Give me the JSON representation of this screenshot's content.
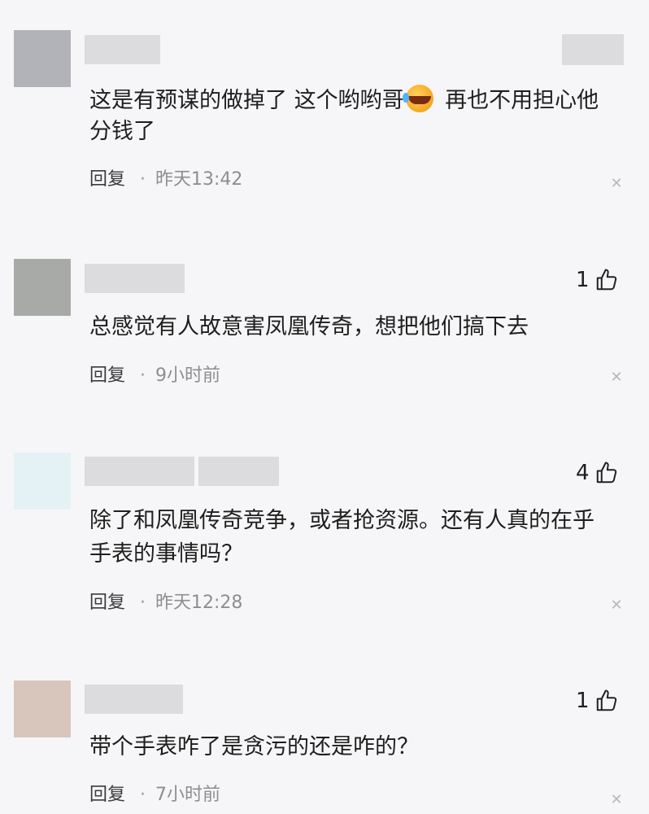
{
  "comments": [
    {
      "text_lines": [
        "这是有预谋的做掉了 这个哟哟哥",
        " 再也不用担心他",
        "分钱了"
      ],
      "emoji": "crying-laughing-emoji",
      "reply_label": "回复",
      "separator": "·",
      "time": "昨天13:42",
      "likes": ""
    },
    {
      "text_lines": [
        "总感觉有人故意害凤凰传奇，想把他们搞下去"
      ],
      "reply_label": "回复",
      "separator": "·",
      "time": "9小时前",
      "likes": "1"
    },
    {
      "text_lines": [
        "除了和凤凰传奇竞争，或者抢资源。还有人真的在乎",
        "手表的事情吗？"
      ],
      "reply_label": "回复",
      "separator": "·",
      "time": "昨天12:28",
      "likes": "4"
    },
    {
      "text_lines": [
        "带个手表咋了是贪污的还是咋的？"
      ],
      "reply_label": "回复",
      "separator": "·",
      "time": "7小时前",
      "likes": "1"
    }
  ],
  "icons": {
    "thumb": "thumbs-up-icon",
    "close": "close-icon"
  },
  "colors": {
    "avatar_1": "#b1b3b8",
    "avatar_2": "#a8aaa7",
    "avatar_3": "#e4f2f5",
    "avatar_4": "#d8c6bd",
    "name_placeholder": "#dcdcdf"
  }
}
